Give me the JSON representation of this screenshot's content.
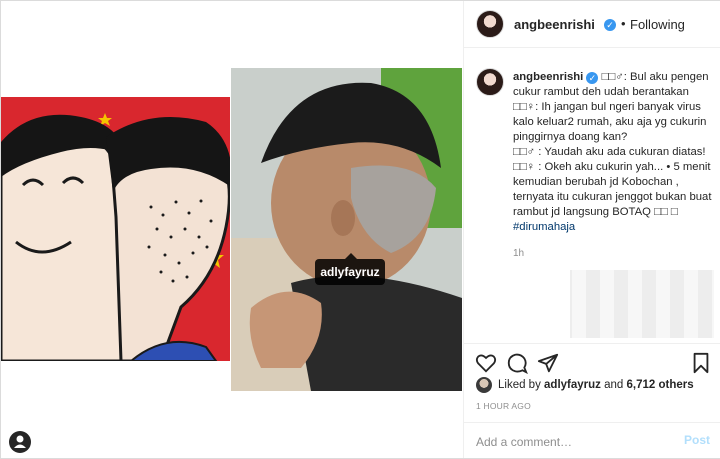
{
  "post": {
    "author": {
      "username": "angbeenrishi",
      "verified": true,
      "follow_status": "Following"
    },
    "media": {
      "tag_label": "adlyfayruz"
    },
    "caption": {
      "username": "angbeenrishi",
      "line1_symbols": "□□♂",
      "line1": ": Bul aku pengen cukur rambut deh udah berantakan",
      "line2_symbols": "□□♀",
      "line2": ": Ih jangan bul ngeri banyak virus kalo keluar2 rumah, aku aja yg cukurin pinggirnya doang kan?",
      "line3_symbols": "□□♂",
      "line3": " : Yaudah aku ada cukuran diatas!",
      "line4_symbols": "□□♀",
      "line4": " : Okeh aku cukurin yah... • 5 menit kemudian berubah jd Kobochan , ternyata itu cukuran jenggot bukan buat rambut jd langsung BOTAQ □□ □ ",
      "hashtag": "#dirumahaja"
    },
    "caption_age": "1h",
    "actions": {
      "like_icon": "heart-icon",
      "comment_icon": "comment-icon",
      "share_icon": "share-icon",
      "save_icon": "bookmark-icon"
    },
    "likes": {
      "prefix": "Liked by ",
      "first_user": "adlyfayruz",
      "middle": " and ",
      "others": "6,712 others"
    },
    "posted_ago": "1 HOUR AGO",
    "comment_box": {
      "placeholder": "Add a comment…",
      "post_label": "Post"
    }
  },
  "colors": {
    "verified_blue": "#3897f0",
    "post_button_disabled": "#b2dffc",
    "left_panel_red": "#d9272e"
  }
}
